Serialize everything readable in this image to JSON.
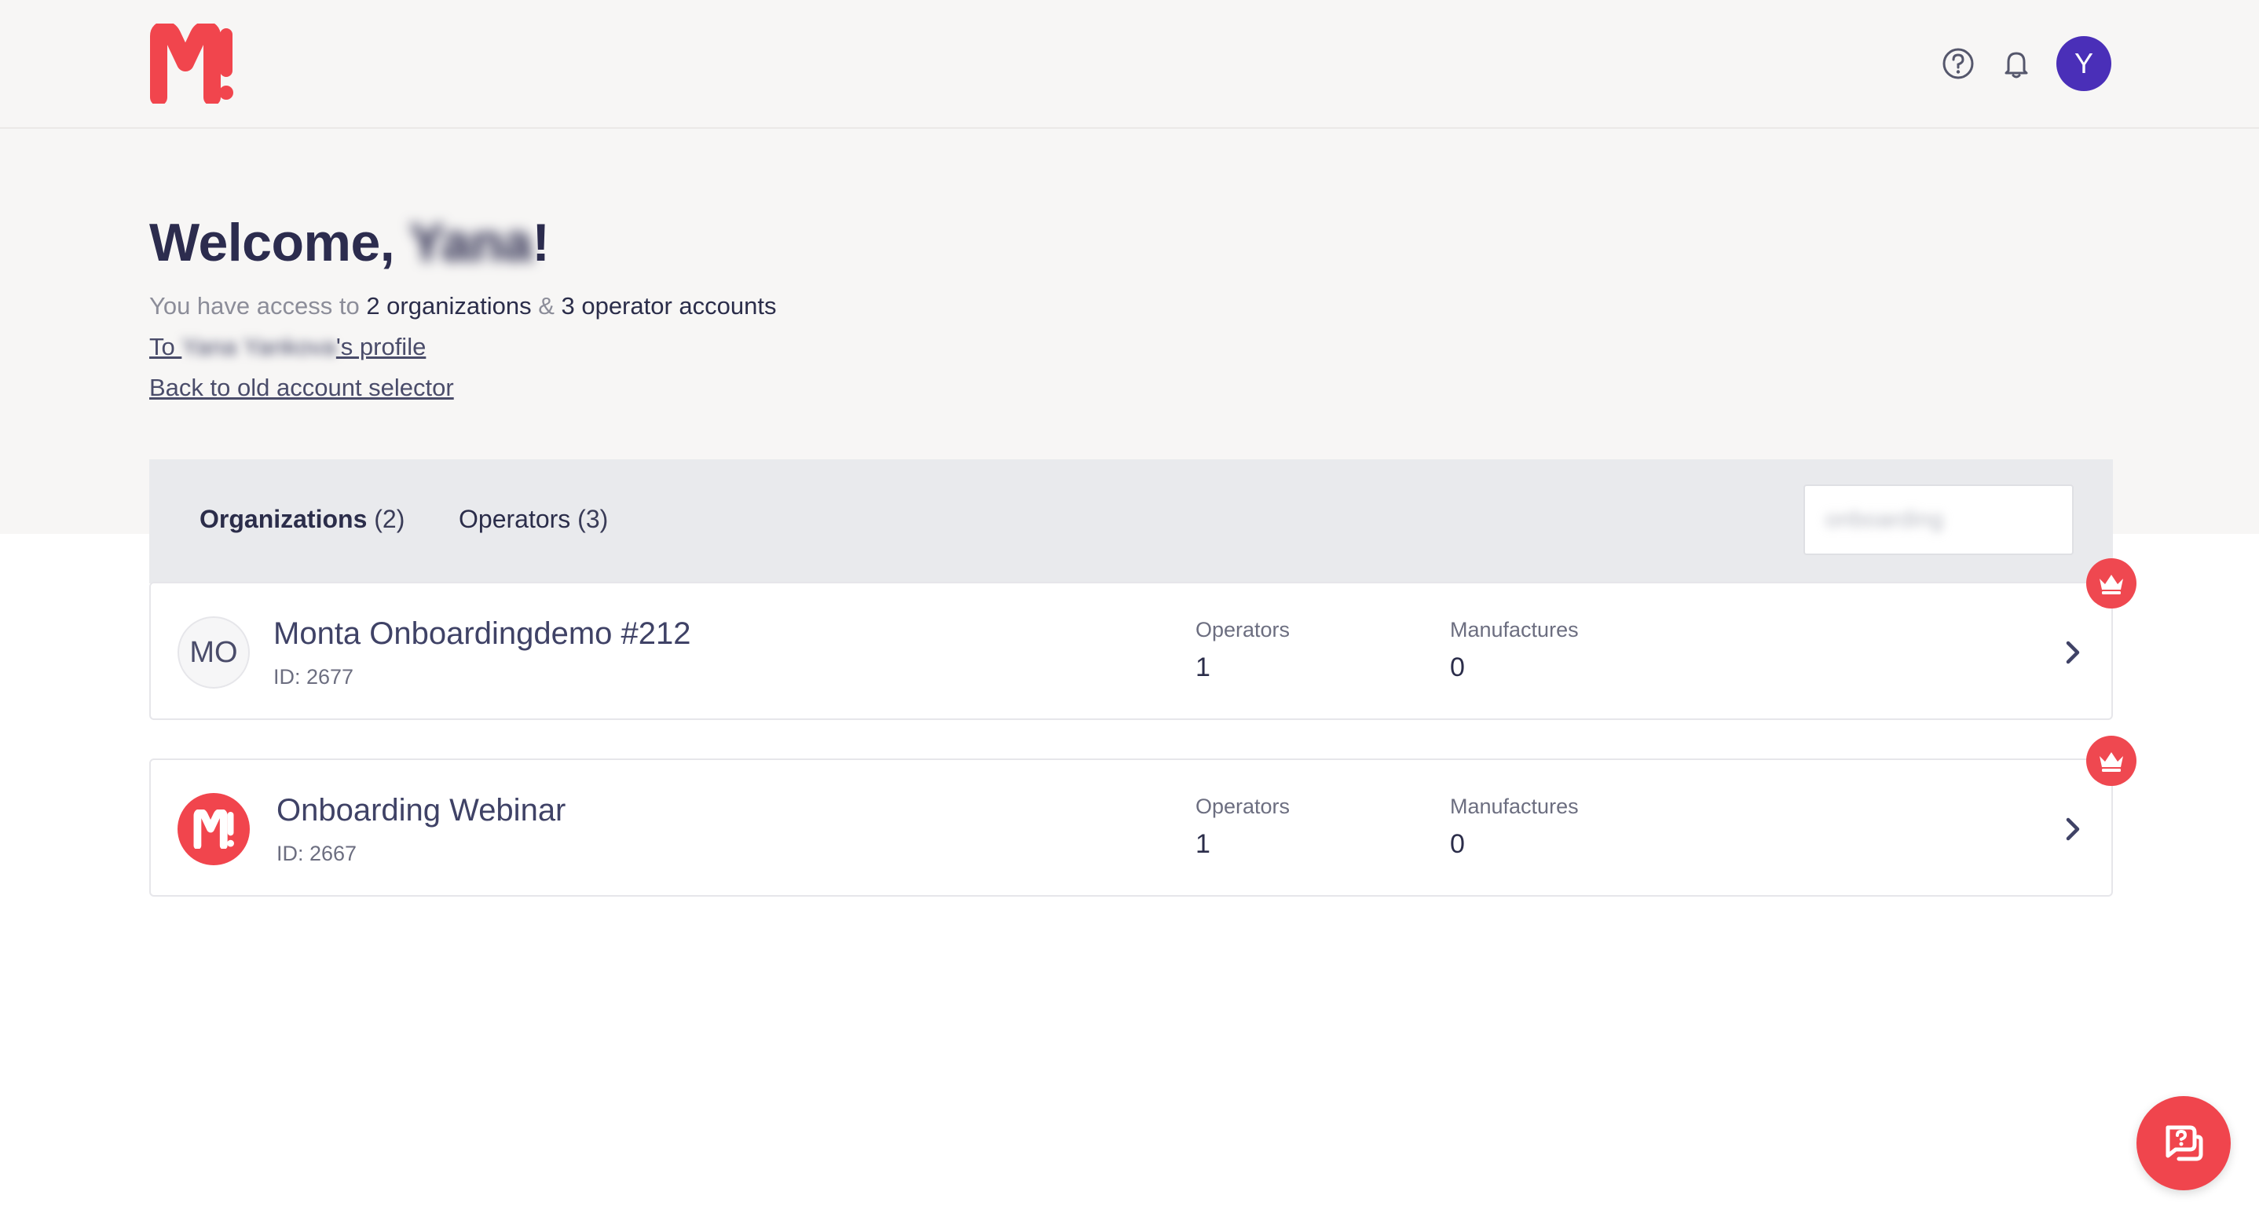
{
  "brand": {
    "logo_text": "M!",
    "color": "#f1454d"
  },
  "header": {
    "help_icon": "question-circle-icon",
    "bell_icon": "bell-icon",
    "avatar_initial": "Y",
    "avatar_color": "#4a2fb8"
  },
  "welcome": {
    "prefix": "Welcome, ",
    "name": "Yana",
    "suffix": "!",
    "access_prefix": "You have access to ",
    "org_count_text": "2 organizations",
    "amp": " & ",
    "op_count_text": "3 operator accounts",
    "profile_prefix": "To ",
    "profile_name": "Yana Yankova",
    "profile_suffix": "'s profile",
    "back_link": "Back to old account selector"
  },
  "tabs": [
    {
      "label": "Organizations",
      "count": "(2)",
      "active": true
    },
    {
      "label": "Operators",
      "count": "(3)",
      "active": false
    }
  ],
  "search": {
    "value": "onboarding"
  },
  "organizations": [
    {
      "initials": "MO",
      "name": "Monta Onboardingdemo #212",
      "id": "ID: 2677",
      "operators_label": "Operators",
      "operators": "1",
      "manufactures_label": "Manufactures",
      "manufactures": "0",
      "badge_icon": "crown-icon"
    },
    {
      "initials": "M!",
      "name": "Onboarding Webinar",
      "id": "ID: 2667",
      "operators_label": "Operators",
      "operators": "1",
      "manufactures_label": "Manufactures",
      "manufactures": "0",
      "badge_icon": "crown-icon"
    }
  ],
  "chat": {
    "icon": "chat-help-icon"
  }
}
